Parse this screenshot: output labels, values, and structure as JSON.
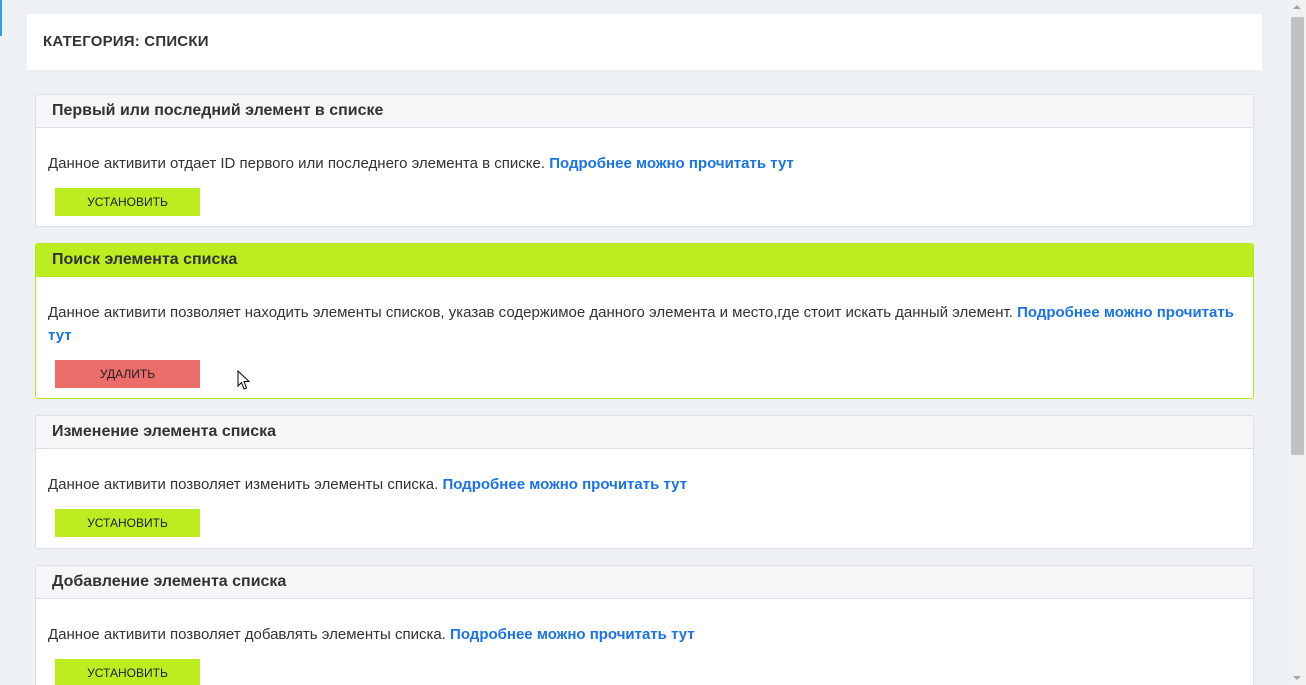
{
  "category": {
    "title": "КАТЕГОРИЯ: СПИСКИ"
  },
  "panels": [
    {
      "title": "Первый или последний элемент в списке",
      "description": "Данное активити отдает ID первого или последнего элемента в списке.",
      "link": "Подробнее можно прочитать тут",
      "button": "УСТАНОВИТЬ"
    },
    {
      "title": "Поиск элемента списка",
      "description": "Данное активити позволяет находить элементы списков, указав содержимое данного элемента и место,где стоит искать данный элемент.",
      "link": "Подробнее можно прочитать тут",
      "button": "УДАЛИТЬ"
    },
    {
      "title": "Изменение элемента списка",
      "description": "Данное активити позволяет изменить элементы списка.",
      "link": "Подробнее можно прочитать тут",
      "button": "УСТАНОВИТЬ"
    },
    {
      "title": "Добавление элемента списка",
      "description": "Данное активити позволяет добавлять элементы списка.",
      "link": "Подробнее можно прочитать тут",
      "button": "УСТАНОВИТЬ"
    }
  ],
  "colors": {
    "install": "#bbed21",
    "remove": "#ea6d6a",
    "link": "#1a73e8",
    "active_header": "#bbed21"
  }
}
